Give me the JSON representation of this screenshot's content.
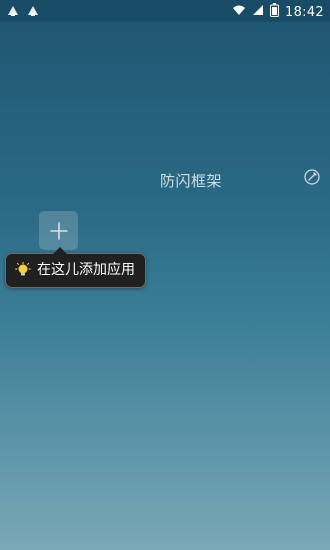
{
  "status_bar": {
    "time": "18:42",
    "left_icons": [
      "android-icon",
      "android-icon"
    ],
    "right_icons": [
      "wifi-icon",
      "signal-icon",
      "battery-icon"
    ]
  },
  "frame": {
    "title": "防闪框架",
    "edit_icon": "edit-icon",
    "add_icon": "plus-icon"
  },
  "tooltip": {
    "icon": "lightbulb-icon",
    "text": "在这儿添加应用"
  },
  "colors": {
    "background_top": "#1f5570",
    "background_bottom": "#7aa8b6",
    "tooltip_bg": "#202020",
    "text": "#ffffff"
  }
}
